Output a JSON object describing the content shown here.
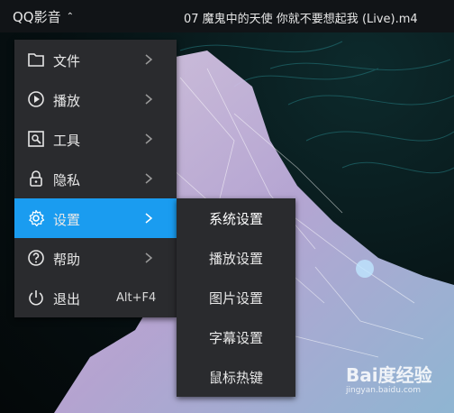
{
  "topbar": {
    "app_title": "QQ影音",
    "file_title": "07 魔鬼中的天使 你就不要想起我 (Live).m4"
  },
  "menu": {
    "items": [
      {
        "label": "文件",
        "icon": "folder-icon",
        "has_submenu": true
      },
      {
        "label": "播放",
        "icon": "play-circle-icon",
        "has_submenu": true
      },
      {
        "label": "工具",
        "icon": "tools-icon",
        "has_submenu": true
      },
      {
        "label": "隐私",
        "icon": "lock-icon",
        "has_submenu": true
      },
      {
        "label": "设置",
        "icon": "gear-icon",
        "has_submenu": true,
        "active": true
      },
      {
        "label": "帮助",
        "icon": "help-circle-icon",
        "has_submenu": true
      },
      {
        "label": "退出",
        "icon": "power-icon",
        "shortcut": "Alt+F4"
      }
    ]
  },
  "submenu": {
    "items": [
      {
        "label": "系统设置"
      },
      {
        "label": "播放设置"
      },
      {
        "label": "图片设置"
      },
      {
        "label": "字幕设置"
      },
      {
        "label": "鼠标热键"
      }
    ]
  },
  "watermark": {
    "text": "Bai度经验",
    "url": "jingyan.baidu.com"
  },
  "colors": {
    "accent": "#1a9cf0",
    "menu_bg": "#2a2b2e",
    "topbar_bg": "#111417"
  }
}
